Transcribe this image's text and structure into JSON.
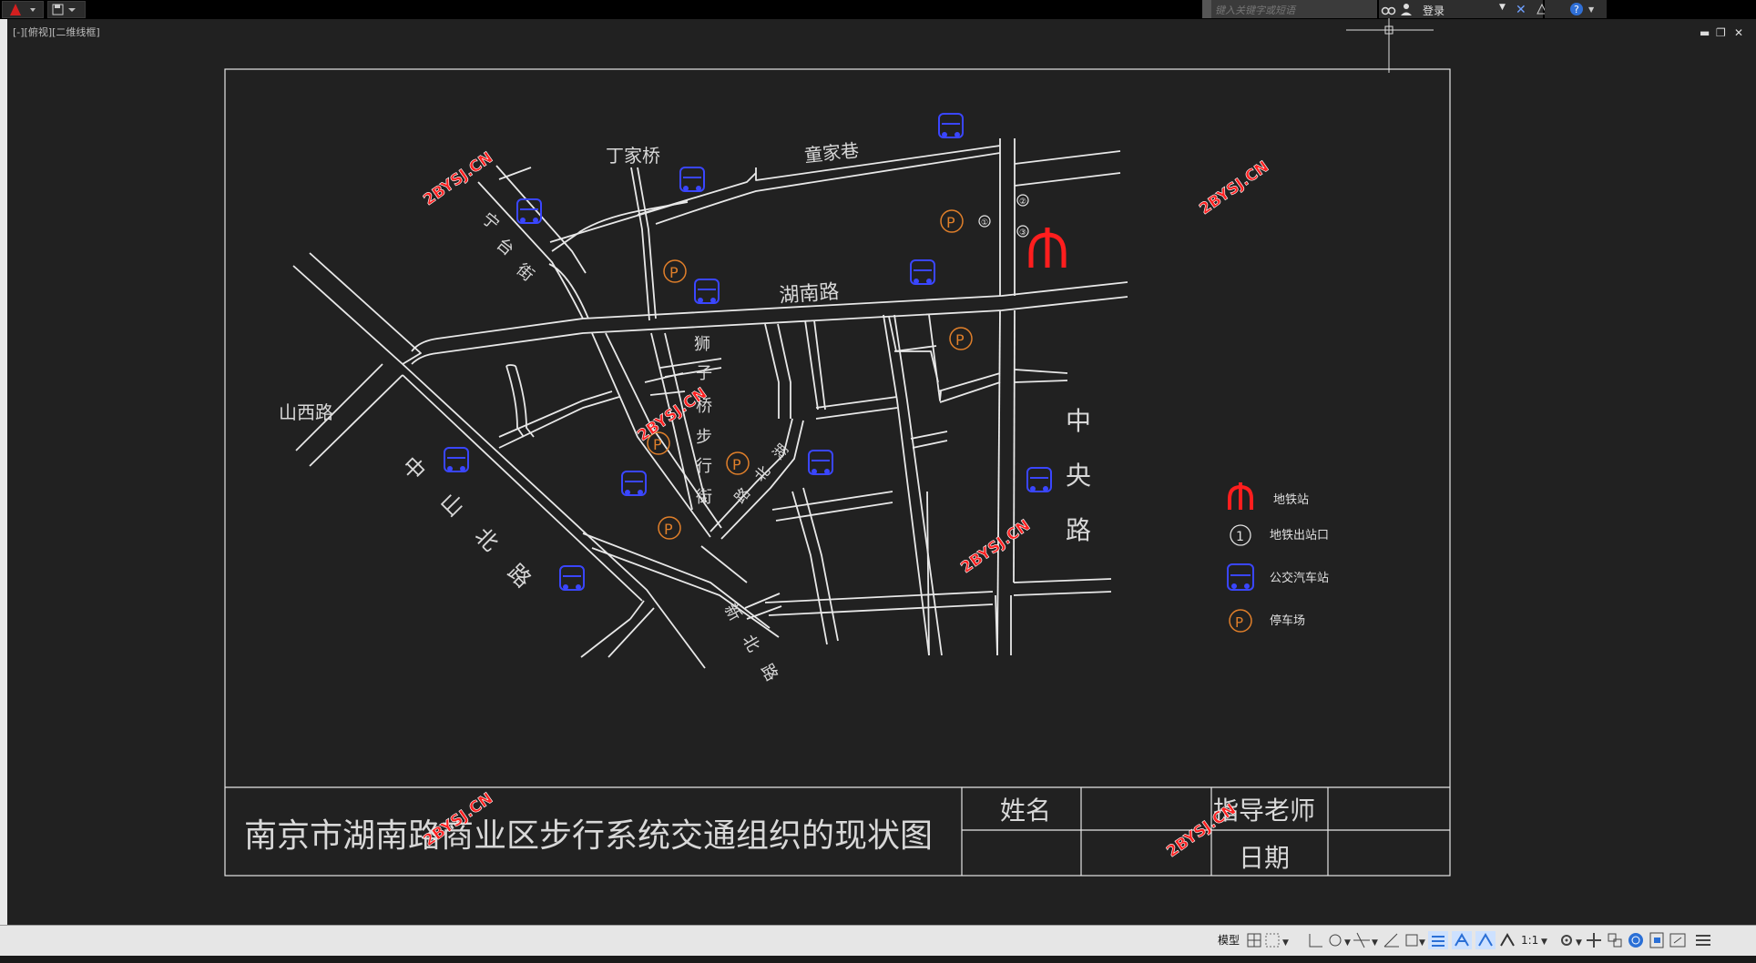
{
  "colors": {
    "background": "#212121",
    "line": "#e8e8e8",
    "metro": "#ff1e1e",
    "bus": "#3a46ff",
    "parking": "#e07f2a",
    "watermark": "#ff2020"
  },
  "window": {
    "search_placeholder": "键入关键字或短语",
    "signin_label": "登录",
    "viewport_label": "[-][俯视][二维线框]"
  },
  "map": {
    "title": "南京市湖南路商业区步行系统交通组织的现状图",
    "titleblock": {
      "name_label": "姓名",
      "advisor_label": "指导老师",
      "date_label": "日期"
    },
    "roads": {
      "dingjiaqiao": "丁家桥",
      "tongjiaxiang": "童家巷",
      "hunan_road": "湖南路",
      "shanxi_road": "山西路",
      "ningtaijie": [
        "宁",
        "台",
        "街"
      ],
      "shizi_street": [
        "狮",
        "子",
        "桥",
        "步",
        "行",
        "街"
      ],
      "zhongshanbei": [
        "中",
        "山",
        "北",
        "路"
      ],
      "zhongyang": [
        "中",
        "央",
        "路"
      ],
      "hunanbei_small": [
        "湖",
        "北",
        "路"
      ],
      "xiaobei": [
        "新",
        "北",
        "路"
      ]
    },
    "exit_markers": [
      "①",
      "②",
      "③"
    ],
    "watermark": "2BYSJ.CN"
  },
  "legend": {
    "items": [
      {
        "icon": "metro-icon",
        "label": "地铁站"
      },
      {
        "icon": "exit-icon",
        "glyph": "1",
        "label": "地铁出站口"
      },
      {
        "icon": "bus-icon",
        "label": "公交汽车站"
      },
      {
        "icon": "parking-icon",
        "glyph": "P",
        "label": "停车场"
      }
    ]
  },
  "statusbar": {
    "model_tab": "模型",
    "scale": "1:1"
  }
}
